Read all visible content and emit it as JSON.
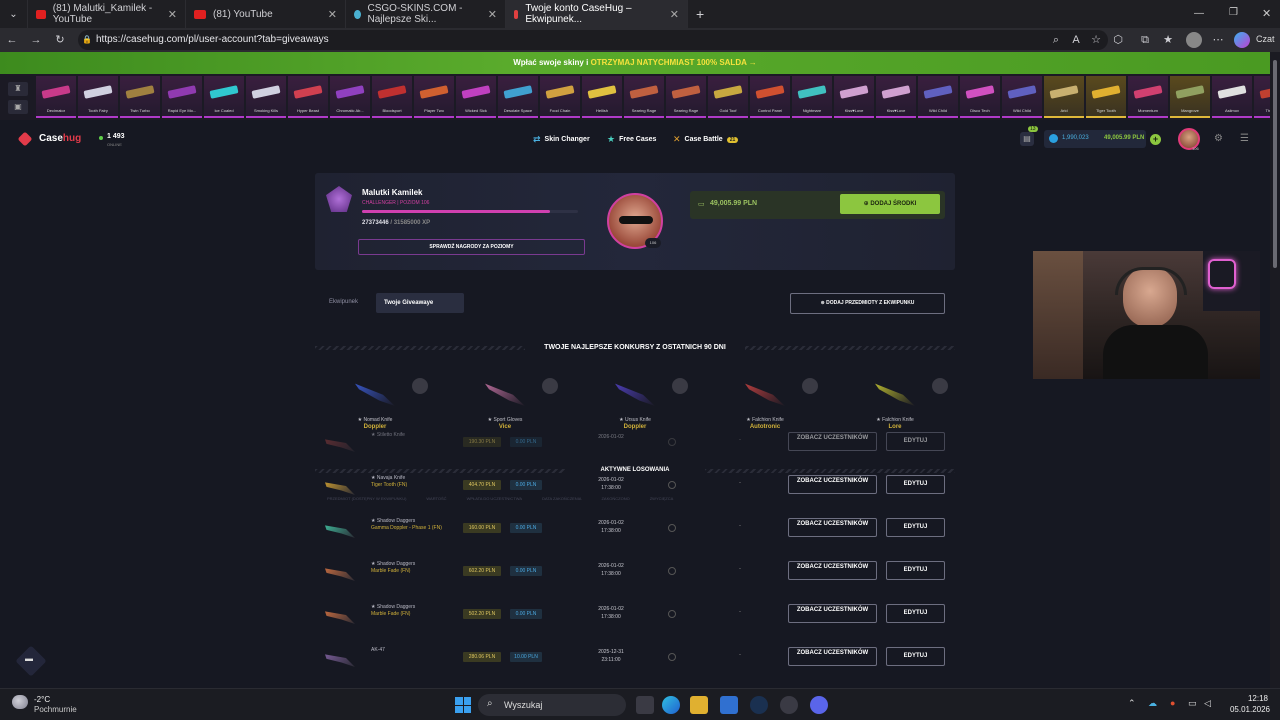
{
  "browser": {
    "tabs": [
      {
        "label": "(81) Malutki_Kamilek - YouTube",
        "color": "#e02020"
      },
      {
        "label": "(81) YouTube",
        "color": "#e02020"
      },
      {
        "label": "CSGO-SKINS.COM - Najlepsze Ski...",
        "color": "#4ab0d0"
      },
      {
        "label": "Twoje konto CaseHug – Ekwipunek...",
        "color": "#e04040"
      }
    ],
    "new_tab": "+",
    "url": "https://casehug.com/pl/user-account?tab=giveaways",
    "copilot_label": "Czat"
  },
  "promo": {
    "text": "Wpłać swoje skiny i",
    "highlight": "OTRZYMAJ NATYCHMIAST 100% SALDA →"
  },
  "ticker": {
    "items": [
      {
        "name": "Decimator",
        "color": "#c83a8a"
      },
      {
        "name": "Tooth Fairy",
        "color": "#d0d0e0"
      },
      {
        "name": "Twin Turbo",
        "color": "#a08040"
      },
      {
        "name": "Rapid Eye Mo...",
        "color": "#903ab0"
      },
      {
        "name": "Ice Coaled",
        "color": "#30c8d0"
      },
      {
        "name": "Smoking Kills",
        "color": "#d0d0e0"
      },
      {
        "name": "Hyper Beast",
        "color": "#d04050"
      },
      {
        "name": "Chromatic Ab...",
        "color": "#9040c0"
      },
      {
        "name": "Bloodsport",
        "color": "#c03030"
      },
      {
        "name": "Player Two",
        "color": "#d06030"
      },
      {
        "name": "Wicked Sick",
        "color": "#c040c0"
      },
      {
        "name": "Desolate Space",
        "color": "#40a0d0"
      },
      {
        "name": "Food Chain",
        "color": "#d0a040"
      },
      {
        "name": "Hellish",
        "color": "#e0c040"
      },
      {
        "name": "Searing Rage",
        "color": "#c06040"
      },
      {
        "name": "Searing Rage",
        "color": "#c06040"
      },
      {
        "name": "Gold Toof",
        "color": "#c8a840"
      },
      {
        "name": "Control Panel",
        "color": "#d05030"
      },
      {
        "name": "Nightmare",
        "color": "#40c0c0"
      },
      {
        "name": "Kiss♥Love",
        "color": "#d0a0d0"
      },
      {
        "name": "Kiss♥Love",
        "color": "#d0a0d0"
      },
      {
        "name": "Wild Child",
        "color": "#6060c0"
      },
      {
        "name": "Disco Tech",
        "color": "#d050c0"
      },
      {
        "name": "Wild Child",
        "color": "#6060c0"
      },
      {
        "name": "Arid",
        "color": "#c8b070",
        "gold": true
      },
      {
        "name": "Tiger Tooth",
        "color": "#e0b030",
        "gold": true
      },
      {
        "name": "Momentum",
        "color": "#d04070"
      },
      {
        "name": "Mangrove",
        "color": "#90a060",
        "gold": true
      },
      {
        "name": "Asiimov",
        "color": "#e0e0e0"
      },
      {
        "name": "The Tra...",
        "color": "#c04030"
      }
    ]
  },
  "header": {
    "logo_a": "Case",
    "logo_b": "hug",
    "online_count": "1 493",
    "online_label": "ONLINE",
    "nav": {
      "skin_changer": "Skin Changer",
      "free_cases": "Free Cases",
      "case_battle": "Case Battle",
      "battle_count": "21"
    },
    "gift_count": "13",
    "coins": "1,990,023",
    "balance": "49,005.99 PLN",
    "avatar_level": "106"
  },
  "profile": {
    "username": "Malutki Kamilek",
    "rank_line": "CHALLENGER | POZIOM 106",
    "xp_current": "27373446",
    "xp_total": "/ 31585000 XP",
    "xp_progress": 0.87,
    "rewards_button": "SPRAWDŹ NAGRODY ZA POZIOMY",
    "avatar_level": "106",
    "balance": "49,005.99 PLN",
    "add_funds_button": "DODAJ ŚRODKI"
  },
  "tabs": {
    "inventory": "Ekwipunek",
    "giveaways": "Twoje Giveawaye",
    "add_items_button": "DODAJ PRZEDMIOTY Z EKWIPUNKU"
  },
  "best_section": {
    "title": "TWOJE NAJLEPSZE KONKURSY Z OSTATNICH 90 DNI",
    "cards": [
      {
        "name": "★ Nomad Knife",
        "skin": "Doppler",
        "color": "#3a5ad0"
      },
      {
        "name": "★ Sport Gloves",
        "skin": "Vice",
        "color": "#c070a0"
      },
      {
        "name": "★ Ursus Knife",
        "skin": "Doppler",
        "color": "#5040c0"
      },
      {
        "name": "★ Falchion Knife",
        "skin": "Autotronic",
        "color": "#c04040"
      },
      {
        "name": "★ Falchion Knife",
        "skin": "Lore",
        "color": "#c0c030"
      }
    ]
  },
  "active_section": {
    "title": "AKTYWNE LOSOWANIA",
    "faint_header": [
      "PRZEDMIOT (DOSTĘPNY W EKWIPUNKU)",
      "WARTOŚĆ",
      "WPŁATA DO UCZESTNICTWA",
      "DATA ZAKOŃCZENIA",
      "ZAKOŃCZONO",
      "ZWYCIĘZCA"
    ],
    "see_label": "ZOBACZ UCZESTNIKÓW",
    "edit_label": "EDYTUJ",
    "rows": [
      {
        "name": "★ Stiletto Knife",
        "skin": "",
        "value": "190.30 PLN",
        "entry": "0.00 PLN",
        "date": "2026-01-02",
        "time": "",
        "winner": "-",
        "color": "#a04040"
      },
      {
        "name": "★ Navaja Knife",
        "skin": "Tiger Tooth (FN)",
        "value": "404.70 PLN",
        "entry": "0.00 PLN",
        "date": "2026-01-02",
        "time": "17:38:00",
        "winner": "-",
        "color": "#d0a030"
      },
      {
        "name": "★ Shadow Daggers",
        "skin": "Gamma Doppler - Phase 1 (FN)",
        "value": "160.00 PLN",
        "entry": "0.00 PLN",
        "date": "2026-01-02",
        "time": "17:38:00",
        "winner": "-",
        "color": "#40c0a0"
      },
      {
        "name": "★ Shadow Daggers",
        "skin": "Marble Fade (FN)",
        "value": "602.20 PLN",
        "entry": "0.00 PLN",
        "date": "2026-01-02",
        "time": "17:38:00",
        "winner": "-",
        "color": "#d07040"
      },
      {
        "name": "★ Shadow Daggers",
        "skin": "Marble Fade (FN)",
        "value": "502.20 PLN",
        "entry": "0.00 PLN",
        "date": "2026-01-02",
        "time": "17:38:00",
        "winner": "-",
        "color": "#d07040"
      },
      {
        "name": "AK-47",
        "skin": "",
        "value": "280.06 PLN",
        "entry": "10.00 PLN",
        "date": "2025-12-31",
        "time": "23:11:00",
        "winner": "-",
        "color": "#8060a0"
      }
    ]
  },
  "taskbar": {
    "temp": "-2°C",
    "weather": "Pochmurnie",
    "search": "Wyszukaj",
    "time": "12:18",
    "date": "05.01.2026"
  }
}
